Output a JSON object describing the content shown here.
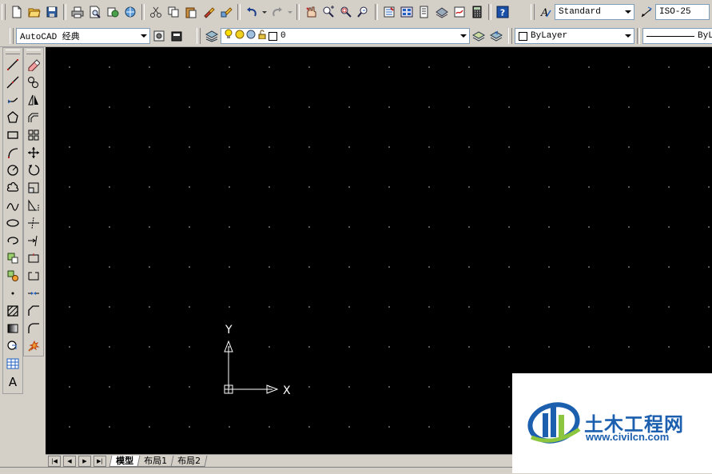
{
  "toolbar": {
    "text_style": "Standard",
    "dim_style": "ISO-25",
    "icons_row1": [
      "new-file-icon",
      "open-folder-icon",
      "save-icon",
      "print-icon",
      "print-preview-icon",
      "publish-icon",
      "3d-dwf-icon",
      "cut-icon",
      "copy-icon",
      "paste-icon",
      "match-properties-icon",
      "block-editor-icon",
      "undo-icon",
      "redo-icon",
      "pan-icon",
      "zoom-realtime-icon",
      "zoom-window-icon",
      "zoom-previous-icon",
      "properties-icon",
      "design-center-icon",
      "tool-palettes-icon",
      "sheet-set-icon",
      "markup-icon",
      "calculator-icon",
      "help-icon"
    ]
  },
  "workspace": {
    "name": "AutoCAD 经典"
  },
  "layer": {
    "current": "0"
  },
  "properties": {
    "color": "ByLayer",
    "linetype": "ByLa"
  },
  "draw_tools": [
    "line-icon",
    "construction-line-icon",
    "polyline-icon",
    "polygon-icon",
    "rectangle-icon",
    "arc-icon",
    "circle-icon",
    "revision-cloud-icon",
    "spline-icon",
    "ellipse-icon",
    "ellipse-arc-icon",
    "insert-block-icon",
    "make-block-icon",
    "point-icon",
    "hatch-icon",
    "gradient-icon",
    "region-icon",
    "table-icon",
    "multiline-text-icon"
  ],
  "modify_tools": [
    "erase-icon",
    "copy-object-icon",
    "mirror-icon",
    "offset-icon",
    "array-icon",
    "move-icon",
    "rotate-icon",
    "scale-icon",
    "stretch-icon",
    "trim-icon",
    "extend-icon",
    "break-at-point-icon",
    "break-icon",
    "join-icon",
    "chamfer-icon",
    "fillet-icon",
    "explode-icon"
  ],
  "ucs": {
    "x_label": "X",
    "y_label": "Y"
  },
  "tabs": [
    {
      "label": "模型",
      "active": true
    },
    {
      "label": "布局1",
      "active": false
    },
    {
      "label": "布局2",
      "active": false
    }
  ],
  "watermark": {
    "title": "土木工程网",
    "url": "www.civilcn.com",
    "brand_color": "#1b5fae",
    "accent_color": "#8cc63f"
  },
  "colors": {
    "canvas": "#000000",
    "chrome": "#d4d0c8",
    "grid_dot": "#6a6a6a"
  }
}
